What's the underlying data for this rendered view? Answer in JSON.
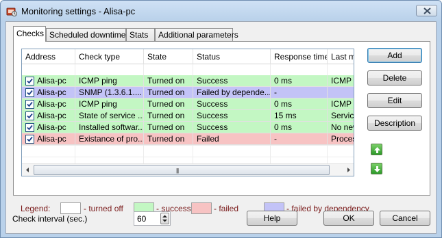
{
  "window": {
    "title": "Monitoring settings - Alisa-pc"
  },
  "tabs": [
    {
      "label": "Checks",
      "active": true
    },
    {
      "label": "Scheduled downtime",
      "active": false
    },
    {
      "label": "Stats",
      "active": false
    },
    {
      "label": "Additional parameters",
      "active": false
    }
  ],
  "table": {
    "columns": [
      "Address",
      "Check type",
      "State",
      "Status",
      "Response time",
      "Last mes"
    ],
    "rows": [
      {
        "checked": true,
        "address": "Alisa-pc",
        "check_type": "ICMP ping",
        "state": "Turned on",
        "status": "Success",
        "response_time": "0 ms",
        "last": "ICMP pir",
        "kind": "success"
      },
      {
        "checked": true,
        "address": "Alisa-pc",
        "check_type": "SNMP (1.3.6.1....",
        "state": "Turned on",
        "status": "Failed by depende...",
        "response_time": "-",
        "last": "",
        "kind": "dependency"
      },
      {
        "checked": true,
        "address": "Alisa-pc",
        "check_type": "ICMP ping",
        "state": "Turned on",
        "status": "Success",
        "response_time": "0 ms",
        "last": "ICMP pir",
        "kind": "success"
      },
      {
        "checked": true,
        "address": "Alisa-pc",
        "check_type": "State of service ...",
        "state": "Turned on",
        "status": "Success",
        "response_time": "15 ms",
        "last": "Service '",
        "kind": "success"
      },
      {
        "checked": true,
        "address": "Alisa-pc",
        "check_type": "Installed softwar...",
        "state": "Turned on",
        "status": "Success",
        "response_time": "0 ms",
        "last": "No new",
        "kind": "success"
      },
      {
        "checked": true,
        "address": "Alisa-pc",
        "check_type": "Existance of pro...",
        "state": "Turned on",
        "status": "Failed",
        "response_time": "-",
        "last": "Process",
        "kind": "failed"
      }
    ]
  },
  "buttons": {
    "add": "Add",
    "delete": "Delete",
    "edit": "Edit",
    "description": "Description",
    "help": "Help",
    "ok": "OK",
    "cancel": "Cancel"
  },
  "legend": {
    "label": "Legend:",
    "turned_off": "- turned off",
    "success": "- success",
    "failed": "- failed",
    "dependency": "- failed by dependency"
  },
  "check_interval": {
    "label": "Check interval (sec.)",
    "value": "60"
  },
  "colors": {
    "success": "#c3f7c3",
    "failed": "#f7c3c3",
    "dependency": "#c3c3f7",
    "turned_off": "#ffffff",
    "failed_text": "#7a1b1b"
  },
  "icons": {
    "app": "monitoring-icon",
    "close": "close-icon",
    "move_up": "arrow-up-icon",
    "move_down": "arrow-down-icon"
  }
}
